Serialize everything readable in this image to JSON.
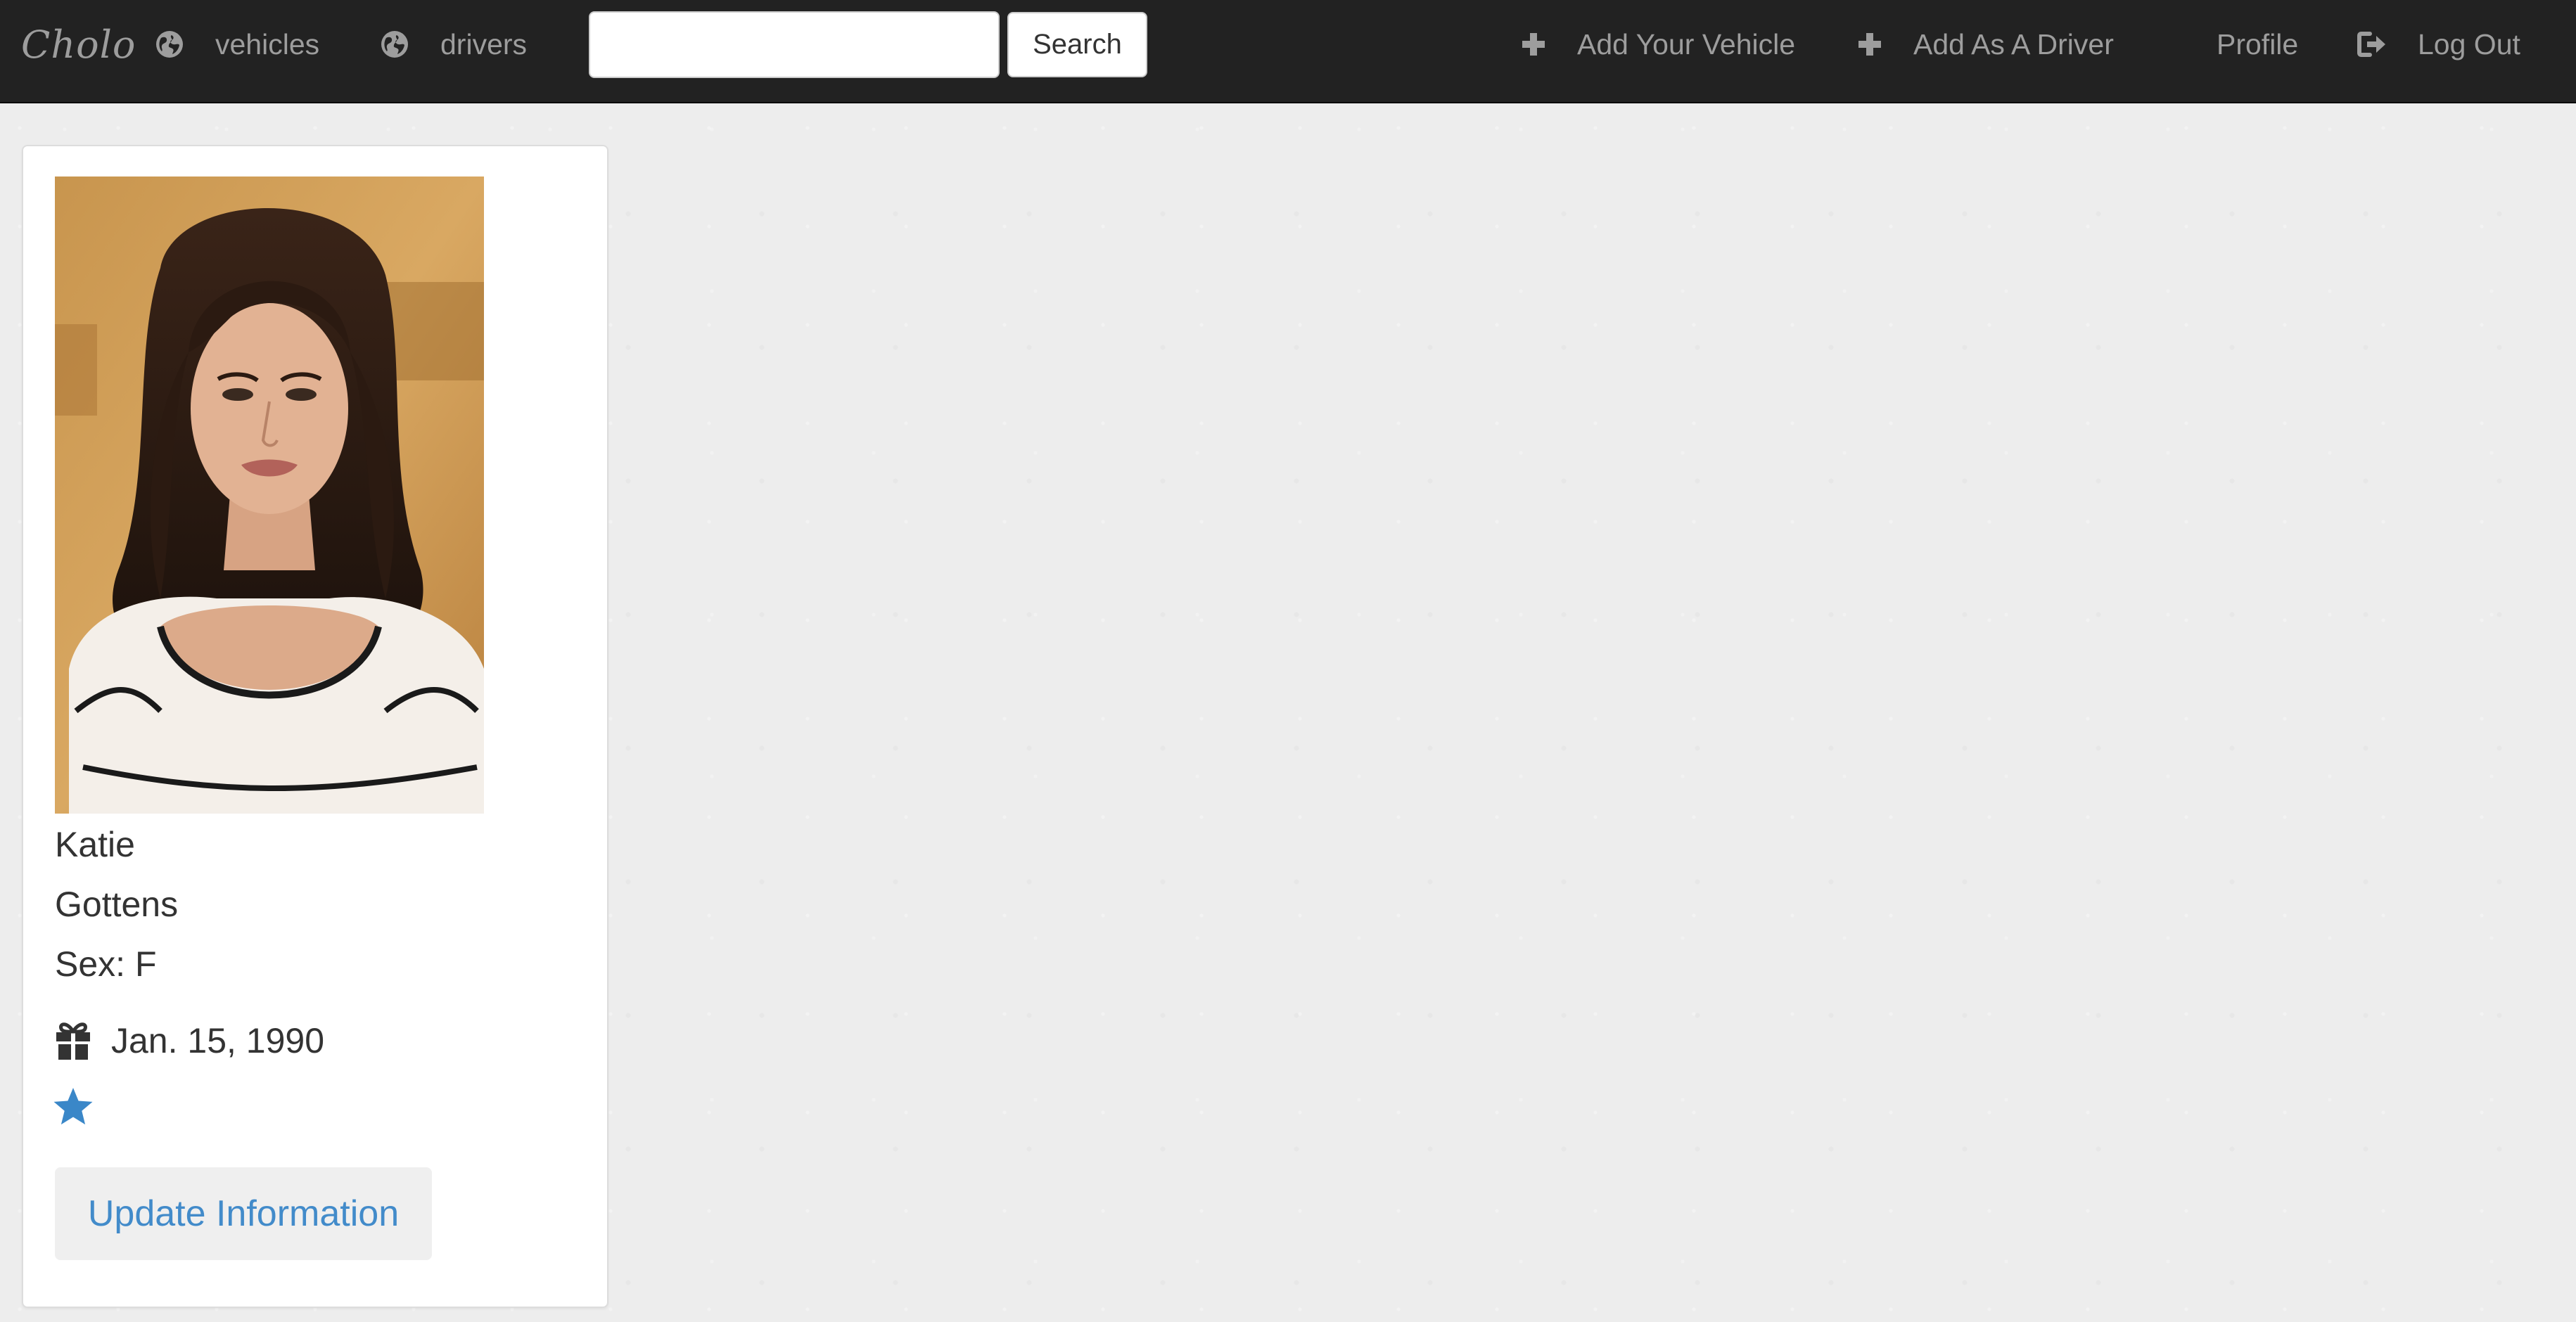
{
  "navbar": {
    "brand": "Cholo",
    "links": {
      "vehicles": {
        "label": "vehicles",
        "icon": "globe-icon"
      },
      "drivers": {
        "label": "drivers",
        "icon": "globe-icon"
      },
      "add_vehicle": {
        "label": "Add Your Vehicle",
        "icon": "plus-icon"
      },
      "add_driver": {
        "label": "Add As A Driver",
        "icon": "plus-icon"
      },
      "profile": {
        "label": "Profile"
      },
      "logout": {
        "label": "Log Out",
        "icon": "log-out-icon"
      }
    },
    "search": {
      "value": "",
      "placeholder": "",
      "button_label": "Search"
    }
  },
  "profile": {
    "photo_alt": "Katie Gottens profile photo",
    "first_name": "Katie",
    "last_name": "Gottens",
    "sex_line": "Sex: F",
    "birth_date": "Jan. 15, 1990",
    "birth_icon": "gift-icon",
    "rating_icon": "star-icon",
    "rating_stars": 1,
    "update_label": "Update Information"
  },
  "colors": {
    "navbar_bg": "#222222",
    "navbar_text": "#9d9d9d",
    "page_bg": "#ededed",
    "accent": "#428bca",
    "star": "#3a87c8"
  }
}
